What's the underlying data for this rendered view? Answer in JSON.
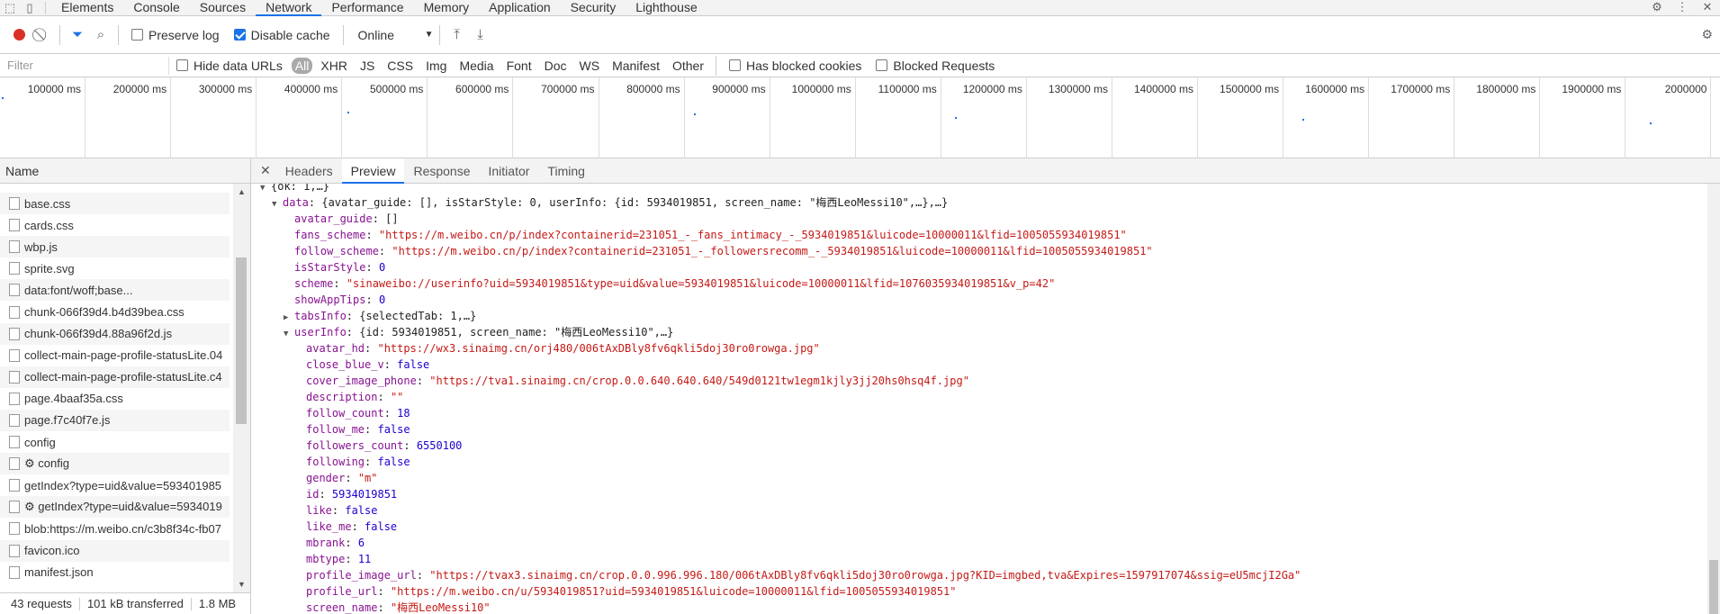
{
  "tabs": [
    "Elements",
    "Console",
    "Sources",
    "Network",
    "Performance",
    "Memory",
    "Application",
    "Security",
    "Lighthouse"
  ],
  "active_tab": "Network",
  "toolbar": {
    "preserve_log": "Preserve log",
    "disable_cache": "Disable cache",
    "throttle": "Online"
  },
  "filter": {
    "placeholder": "Filter",
    "hide_data_urls": "Hide data URLs",
    "types": [
      "All",
      "XHR",
      "JS",
      "CSS",
      "Img",
      "Media",
      "Font",
      "Doc",
      "WS",
      "Manifest",
      "Other"
    ],
    "has_blocked_cookies": "Has blocked cookies",
    "blocked_requests": "Blocked Requests"
  },
  "timeline": {
    "ticks": [
      "100000 ms",
      "200000 ms",
      "300000 ms",
      "400000 ms",
      "500000 ms",
      "600000 ms",
      "700000 ms",
      "800000 ms",
      "900000 ms",
      "1000000 ms",
      "1100000 ms",
      "1200000 ms",
      "1300000 ms",
      "1400000 ms",
      "1500000 ms",
      "1600000 ms",
      "1700000 ms",
      "1800000 ms",
      "1900000 ms",
      "2000000"
    ]
  },
  "name_header": "Name",
  "requests": [
    "base.css",
    "cards.css",
    "wbp.js",
    "sprite.svg",
    "data:font/woff;base...",
    "chunk-066f39d4.b4d39bea.css",
    "chunk-066f39d4.88a96f2d.js",
    "collect-main-page-profile-statusLite.04",
    "collect-main-page-profile-statusLite.c4",
    "page.4baaf35a.css",
    "page.f7c40f7e.js",
    "config",
    "⚙ config",
    "getIndex?type=uid&value=593401985",
    "⚙ getIndex?type=uid&value=5934019",
    "blob:https://m.weibo.cn/c3b8f34c-fb07",
    "favicon.ico",
    "manifest.json"
  ],
  "footer": {
    "requests": "43 requests",
    "transferred": "101 kB transferred",
    "resources": "1.8 MB"
  },
  "detail_tabs": [
    "Headers",
    "Preview",
    "Response",
    "Initiator",
    "Timing"
  ],
  "active_detail_tab": "Preview",
  "preview_lines": [
    {
      "indent": 0,
      "tri": "▼",
      "key": "",
      "val": "{ok: 1,…}",
      "type": "plain"
    },
    {
      "indent": 1,
      "tri": "▼",
      "key": "data",
      "val": "{avatar_guide: [], isStarStyle: 0, userInfo: {id: 5934019851, screen_name: \"梅西LeoMessi10\",…},…}",
      "type": "plain"
    },
    {
      "indent": 2,
      "tri": "",
      "key": "avatar_guide",
      "val": "[]",
      "type": "plain"
    },
    {
      "indent": 2,
      "tri": "",
      "key": "fans_scheme",
      "val": "\"https://m.weibo.cn/p/index?containerid=231051_-_fans_intimacy_-_5934019851&luicode=10000011&lfid=1005055934019851\"",
      "type": "s"
    },
    {
      "indent": 2,
      "tri": "",
      "key": "follow_scheme",
      "val": "\"https://m.weibo.cn/p/index?containerid=231051_-_followersrecomm_-_5934019851&luicode=10000011&lfid=1005055934019851\"",
      "type": "s"
    },
    {
      "indent": 2,
      "tri": "",
      "key": "isStarStyle",
      "val": "0",
      "type": "n"
    },
    {
      "indent": 2,
      "tri": "",
      "key": "scheme",
      "val": "\"sinaweibo://userinfo?uid=5934019851&type=uid&value=5934019851&luicode=10000011&lfid=1076035934019851&v_p=42\"",
      "type": "s"
    },
    {
      "indent": 2,
      "tri": "",
      "key": "showAppTips",
      "val": "0",
      "type": "n"
    },
    {
      "indent": 2,
      "tri": "▶",
      "key": "tabsInfo",
      "val": "{selectedTab: 1,…}",
      "type": "plain"
    },
    {
      "indent": 2,
      "tri": "▼",
      "key": "userInfo",
      "val": "{id: 5934019851, screen_name: \"梅西LeoMessi10\",…}",
      "type": "plain"
    },
    {
      "indent": 3,
      "tri": "",
      "key": "avatar_hd",
      "val": "\"https://wx3.sinaimg.cn/orj480/006tAxDBly8fv6qkli5doj30ro0rowga.jpg\"",
      "type": "s"
    },
    {
      "indent": 3,
      "tri": "",
      "key": "close_blue_v",
      "val": "false",
      "type": "n"
    },
    {
      "indent": 3,
      "tri": "",
      "key": "cover_image_phone",
      "val": "\"https://tva1.sinaimg.cn/crop.0.0.640.640.640/549d0121tw1egm1kjly3jj20hs0hsq4f.jpg\"",
      "type": "s"
    },
    {
      "indent": 3,
      "tri": "",
      "key": "description",
      "val": "\"\"",
      "type": "s"
    },
    {
      "indent": 3,
      "tri": "",
      "key": "follow_count",
      "val": "18",
      "type": "n"
    },
    {
      "indent": 3,
      "tri": "",
      "key": "follow_me",
      "val": "false",
      "type": "n"
    },
    {
      "indent": 3,
      "tri": "",
      "key": "followers_count",
      "val": "6550100",
      "type": "n"
    },
    {
      "indent": 3,
      "tri": "",
      "key": "following",
      "val": "false",
      "type": "n"
    },
    {
      "indent": 3,
      "tri": "",
      "key": "gender",
      "val": "\"m\"",
      "type": "s"
    },
    {
      "indent": 3,
      "tri": "",
      "key": "id",
      "val": "5934019851",
      "type": "n"
    },
    {
      "indent": 3,
      "tri": "",
      "key": "like",
      "val": "false",
      "type": "n"
    },
    {
      "indent": 3,
      "tri": "",
      "key": "like_me",
      "val": "false",
      "type": "n"
    },
    {
      "indent": 3,
      "tri": "",
      "key": "mbrank",
      "val": "6",
      "type": "n"
    },
    {
      "indent": 3,
      "tri": "",
      "key": "mbtype",
      "val": "11",
      "type": "n"
    },
    {
      "indent": 3,
      "tri": "",
      "key": "profile_image_url",
      "val": "\"https://tvax3.sinaimg.cn/crop.0.0.996.996.180/006tAxDBly8fv6qkli5doj30ro0rowga.jpg?KID=imgbed,tva&Expires=1597917074&ssig=eU5mcjI2Ga\"",
      "type": "s"
    },
    {
      "indent": 3,
      "tri": "",
      "key": "profile_url",
      "val": "\"https://m.weibo.cn/u/5934019851?uid=5934019851&luicode=10000011&lfid=1005055934019851\"",
      "type": "s"
    },
    {
      "indent": 3,
      "tri": "",
      "key": "screen_name",
      "val": "\"梅西LeoMessi10\"",
      "type": "s"
    }
  ]
}
